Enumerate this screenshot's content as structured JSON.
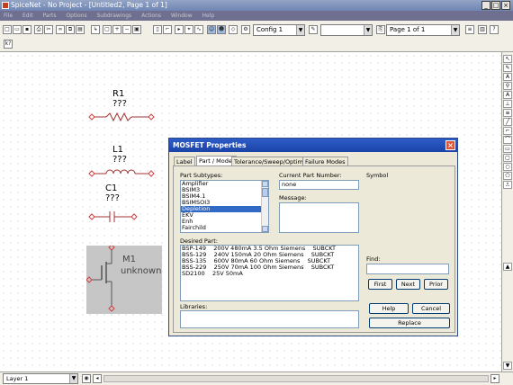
{
  "window": {
    "title": "SpiceNet - No Project - [Untitled2, Page 1 of 1]"
  },
  "menubar": [
    "File",
    "Edit",
    "Parts",
    "Options",
    "Subdrawings",
    "Actions",
    "Window",
    "Help"
  ],
  "toolbar": {
    "config_value": "Config 1",
    "blank_combo_value": "",
    "page_value": "Page 1 of 1"
  },
  "schematic": {
    "r1": {
      "name": "R1",
      "value": "???"
    },
    "l1": {
      "name": "L1",
      "value": "???"
    },
    "c1": {
      "name": "C1",
      "value": "???"
    },
    "m1": {
      "name": "M1",
      "value": "unknown"
    }
  },
  "dialog": {
    "title": "MOSFET Properties",
    "tabs": [
      "Label",
      "Part / Model",
      "Tolerance/Sweep/Optimize",
      "Failure Modes"
    ],
    "active_tab": 1,
    "part_subtypes_label": "Part Subtypes:",
    "part_subtypes": [
      "Amplifier",
      "BSIM3",
      "BSIM4.1",
      "BSIMSOI3",
      "Depletion",
      "EKV",
      "Enh",
      "Fairchild"
    ],
    "selected_subtype": 4,
    "current_part_label": "Current Part Number:",
    "current_part_value": "none",
    "message_label": "Message:",
    "symbol_label": "Symbol",
    "desired_part_label": "Desired Part:",
    "desired_parts": [
      "BSP-149    200V 480mA 3.5 Ohm Siemens    SUBCKT",
      "BSS-129    240V 150mA 20 Ohm Siemens    SUBCKT",
      "BSS-135    600V 80mA 60 Ohm Siemens    SUBCKT",
      "BSS-229    250V 70mA 100 Ohm Siemens    SUBCKT",
      "SD2100    25V 50mA"
    ],
    "find_label": "Find:",
    "find_value": "",
    "first_label": "First",
    "next_label": "Next",
    "prior_label": "Prior",
    "libraries_label": "Libraries:",
    "help_label": "Help",
    "cancel_label": "Cancel",
    "replace_label": "Replace"
  },
  "status": {
    "layer": "Layer 1"
  }
}
